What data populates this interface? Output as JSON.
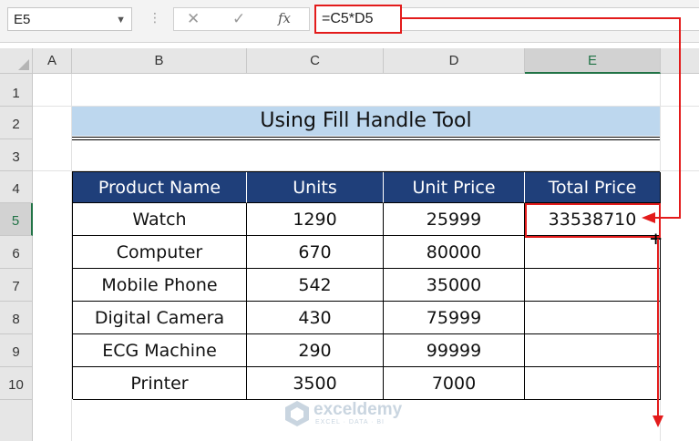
{
  "formula_bar": {
    "name_box": "E5",
    "formula": "=C5*D5",
    "fx_label": "fx"
  },
  "columns": [
    "A",
    "B",
    "C",
    "D",
    "E"
  ],
  "selected_column": "E",
  "rows": [
    "1",
    "2",
    "3",
    "4",
    "5",
    "6",
    "7",
    "8",
    "9",
    "10"
  ],
  "selected_row": "5",
  "title": "Using Fill Handle Tool",
  "table": {
    "headers": [
      "Product Name",
      "Units",
      "Unit Price",
      "Total Price"
    ],
    "rows": [
      [
        "Watch",
        "1290",
        "25999",
        "33538710"
      ],
      [
        "Computer",
        "670",
        "80000",
        ""
      ],
      [
        "Mobile Phone",
        "542",
        "35000",
        ""
      ],
      [
        "Digital Camera",
        "430",
        "75999",
        ""
      ],
      [
        "ECG Machine",
        "290",
        "99999",
        ""
      ],
      [
        "Printer",
        "3500",
        "7000",
        ""
      ]
    ]
  },
  "accent_colors": {
    "header_fill": "#1f3f7a",
    "title_fill": "#bdd7ee",
    "highlight": "#e31b1b",
    "excel_green": "#217346"
  },
  "watermark": {
    "name": "exceldemy",
    "tagline": "EXCEL · DATA · BI"
  }
}
